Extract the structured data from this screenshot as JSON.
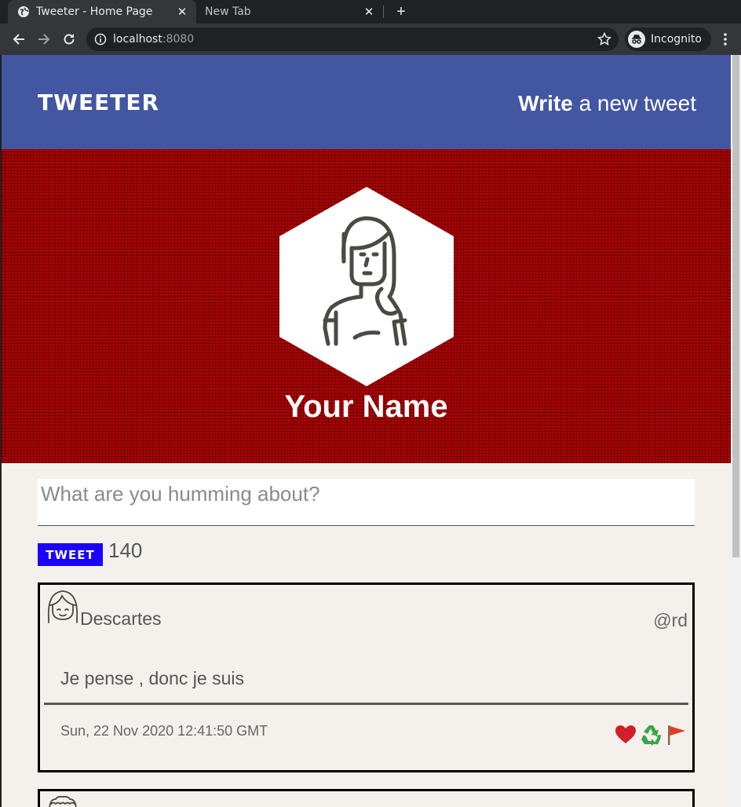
{
  "browser": {
    "tabs": [
      {
        "title": "Tweeter - Home Page",
        "active": true
      },
      {
        "title": "New Tab",
        "active": false
      }
    ],
    "url_host": "localhost",
    "url_port": ":8080",
    "incognito_label": "Incognito"
  },
  "site": {
    "logo": "TWEETER",
    "write_strong": "Write",
    "write_rest": " a new tweet"
  },
  "profile": {
    "name": "Your Name",
    "header_color": "#b00000"
  },
  "composer": {
    "placeholder": "What are you humming about?",
    "button_label": "TWEET",
    "counter": "140"
  },
  "tweets": [
    {
      "name": "Descartes",
      "handle": "@rd",
      "content": "Je pense , donc je suis",
      "date": "Sun, 22 Nov 2020 12:41:50 GMT",
      "actions": [
        "heart-icon",
        "recycle-icon",
        "flag-icon"
      ]
    }
  ],
  "colors": {
    "nav": "#4256a2",
    "tweet_button": "#1a00ff",
    "page_bg": "#f4f1ec"
  }
}
